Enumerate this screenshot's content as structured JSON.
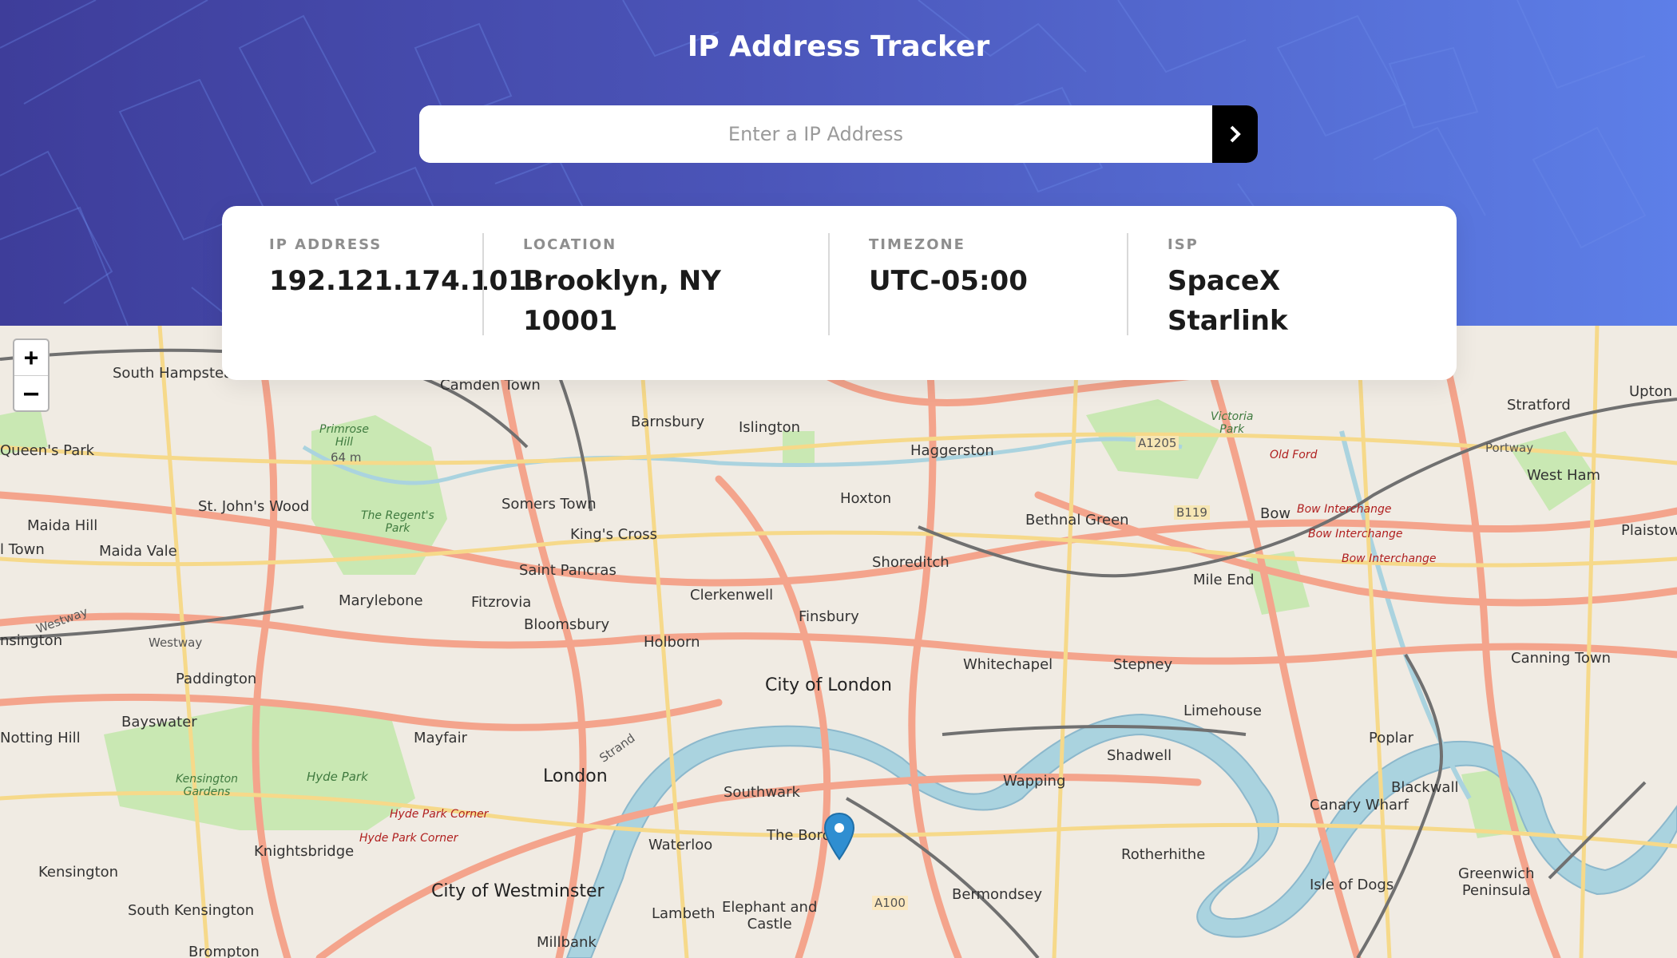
{
  "header": {
    "title": "IP Address Tracker",
    "search_placeholder": "Enter a IP Address",
    "search_value": "",
    "submit_icon": "chevron-right-icon"
  },
  "info": [
    {
      "label": "IP ADDRESS",
      "value": "192.121.174.101"
    },
    {
      "label": "LOCATION",
      "value": "Brooklyn, NY\n10001"
    },
    {
      "label": "TIMEZONE",
      "value": "UTC-05:00"
    },
    {
      "label": "ISP",
      "value": "SpaceX\nStarlink"
    }
  ],
  "map": {
    "zoom_in": "+",
    "zoom_out": "–",
    "marker_icon": "location-pin-icon",
    "labels": {
      "south_hampstead": "South Hampstea",
      "camden": "Camden Town",
      "barnsbury": "Barnsbury",
      "islington": "Islington",
      "haggerston": "Haggerston",
      "victoria_park": "Victoria\nPark",
      "stratford": "Stratford",
      "upton": "Upton",
      "queens_park": "Queen's Park",
      "primrose": "Primrose\nHill",
      "primrose_elev": "64 m",
      "old_ford": "Old Ford",
      "a1205": "A1205",
      "portway": "Portway",
      "west_ham": "West Ham",
      "hoxton": "Hoxton",
      "somers": "Somers Town",
      "st_johns": "St. John's Wood",
      "regents_park": "The Regent's\nPark",
      "maida_hill": "Maida Hill",
      "kings_cross": "King's Cross",
      "bethnal": "Bethnal Green",
      "b119": "B119",
      "bow": "Bow",
      "bow_int_1": "Bow Interchange",
      "bow_int_2": "Bow Interchange",
      "bow_int_3": "Bow Interchange",
      "plaistow": "Plaistow",
      "town": "l Town",
      "maida_vale": "Maida Vale",
      "shoreditch": "Shoreditch",
      "saint_pancras": "Saint Pancras",
      "mile_end": "Mile End",
      "clerkenwell": "Clerkenwell",
      "marylebone": "Marylebone",
      "fitzrovia": "Fitzrovia",
      "westway_1": "Westway",
      "westway_2": "Westway",
      "finsbury": "Finsbury",
      "bloomsbury": "Bloomsbury",
      "nsington": "nsington",
      "holborn": "Holborn",
      "whitechapel": "Whitechapel",
      "stepney": "Stepney",
      "canning": "Canning Town",
      "paddington": "Paddington",
      "city_london": "City of London",
      "limehouse": "Limehouse",
      "bayswater": "Bayswater",
      "poplar": "Poplar",
      "notting": "Notting Hill",
      "mayfair": "Mayfair",
      "strand": "Strand",
      "shadwell": "Shadwell",
      "london": "London",
      "wapping": "Wapping",
      "blackwall": "Blackwall",
      "kensington_gardens": "Kensington\nGardens",
      "hyde_park": "Hyde Park",
      "southwark": "Southwark",
      "canary": "Canary Wharf",
      "hyde_corner_1": "Hyde Park Corner",
      "hyde_corner_2": "Hyde Park Corner",
      "the_boro": "The Boro",
      "knightsbridge": "Knightsbridge",
      "waterloo": "Waterloo",
      "rotherhithe": "Rotherhithe",
      "kensington": "Kensington",
      "greenwich": "Greenwich\nPeninsula",
      "westminster": "City of Westminster",
      "isle_dogs": "Isle of Dogs",
      "bermondsey": "Bermondsey",
      "a100": "A100",
      "south_ken": "South Kensington",
      "lambeth": "Lambeth",
      "elephant": "Elephant and\nCastle",
      "brompton": "Brompton",
      "millbank": "Millbank"
    }
  }
}
